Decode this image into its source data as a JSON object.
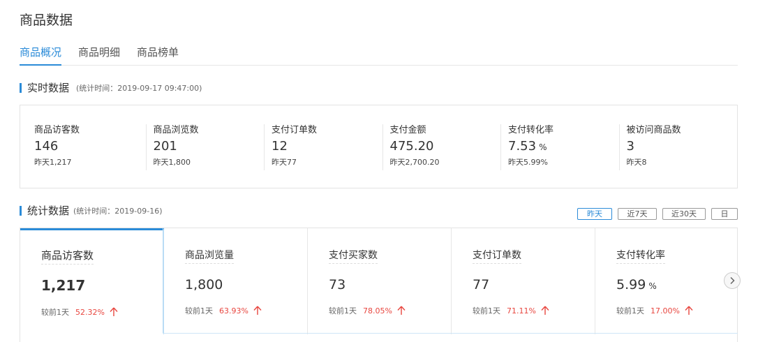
{
  "page": {
    "title": "商品数据"
  },
  "tabs": [
    {
      "label": "商品概况",
      "active": true
    },
    {
      "label": "商品明细",
      "active": false
    },
    {
      "label": "商品榜单",
      "active": false
    }
  ],
  "realtime": {
    "title": "实时数据",
    "stat_time": "(统计时间：2019-09-17 09:47:00)",
    "items": [
      {
        "label": "商品访客数",
        "value": "146",
        "unit": "",
        "yesterday": "昨天1,217"
      },
      {
        "label": "商品浏览数",
        "value": "201",
        "unit": "",
        "yesterday": "昨天1,800"
      },
      {
        "label": "支付订单数",
        "value": "12",
        "unit": "",
        "yesterday": "昨天77"
      },
      {
        "label": "支付金额",
        "value": "475.20",
        "unit": "",
        "yesterday": "昨天2,700.20"
      },
      {
        "label": "支付转化率",
        "value": "7.53",
        "unit": "%",
        "yesterday": "昨天5.99%"
      },
      {
        "label": "被访问商品数",
        "value": "3",
        "unit": "",
        "yesterday": "昨天8"
      }
    ]
  },
  "stats": {
    "title": "统计数据",
    "stat_time": "(统计时间：2019-09-16)",
    "range_buttons": [
      {
        "label": "昨天",
        "active": true
      },
      {
        "label": "近7天",
        "active": false
      },
      {
        "label": "近30天",
        "active": false
      },
      {
        "label": "日",
        "active": false
      }
    ],
    "cards": [
      {
        "label": "商品访客数",
        "value": "1,217",
        "unit": "",
        "compare_label": "较前1天",
        "change": "52.32%",
        "active": true
      },
      {
        "label": "商品浏览量",
        "value": "1,800",
        "unit": "",
        "compare_label": "较前1天",
        "change": "63.93%",
        "active": false
      },
      {
        "label": "支付买家数",
        "value": "73",
        "unit": "",
        "compare_label": "较前1天",
        "change": "78.05%",
        "active": false
      },
      {
        "label": "支付订单数",
        "value": "77",
        "unit": "",
        "compare_label": "较前1天",
        "change": "71.11%",
        "active": false
      },
      {
        "label": "支付转化率",
        "value": "5.99",
        "unit": "%",
        "compare_label": "较前1天",
        "change": "17.00%",
        "active": false
      }
    ]
  },
  "icons": {
    "up_arrow": "arrow-up-icon",
    "next": "chevron-right-icon"
  },
  "colors": {
    "accent": "#2b8bd8",
    "increase": "#e8463f"
  }
}
